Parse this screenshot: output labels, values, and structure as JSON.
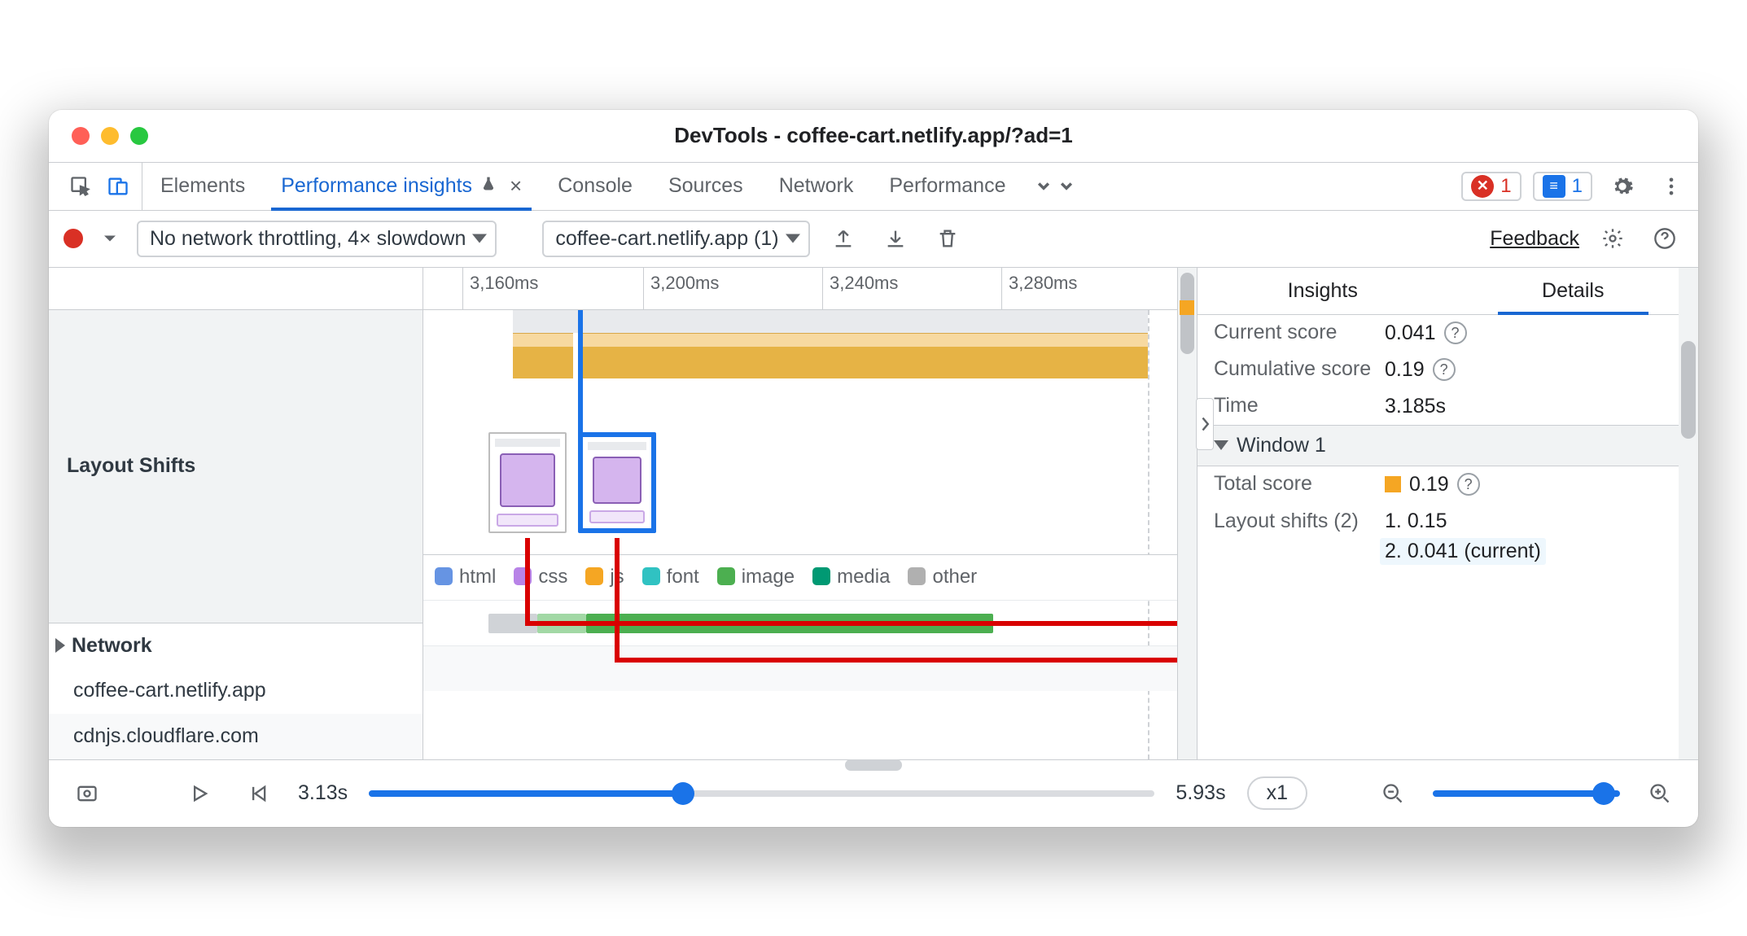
{
  "window": {
    "title": "DevTools - coffee-cart.netlify.app/?ad=1"
  },
  "top_tabs": {
    "items": [
      "Elements",
      "Performance insights",
      "Console",
      "Sources",
      "Network",
      "Performance"
    ],
    "active_index": 1,
    "experiment_badge": true,
    "error_count": "1",
    "message_count": "1"
  },
  "toolbar": {
    "throttling_select": "No network throttling, 4× slowdown",
    "recording_select": "coffee-cart.netlify.app (1)",
    "feedback_label": "Feedback"
  },
  "timeline": {
    "ticks": [
      "3,160ms",
      "3,200ms",
      "3,240ms",
      "3,280ms"
    ],
    "layout_shifts_label": "Layout Shifts",
    "network_label": "Network",
    "legend": [
      "html",
      "css",
      "js",
      "font",
      "image",
      "media",
      "other"
    ],
    "hosts": [
      "coffee-cart.netlify.app",
      "cdnjs.cloudflare.com"
    ]
  },
  "details": {
    "tabs": [
      "Insights",
      "Details"
    ],
    "active_tab": 1,
    "current_score_label": "Current score",
    "current_score_value": "0.041",
    "cumulative_score_label": "Cumulative score",
    "cumulative_score_value": "0.19",
    "time_label": "Time",
    "time_value": "3.185s",
    "window_section": "Window 1",
    "total_score_label": "Total score",
    "total_score_value": "0.19",
    "layout_shifts_label": "Layout shifts (2)",
    "shifts": [
      {
        "idx": "1.",
        "value": "0.15",
        "suffix": ""
      },
      {
        "idx": "2.",
        "value": "0.041",
        "suffix": "(current)"
      }
    ]
  },
  "playback": {
    "start_label": "3.13s",
    "end_label": "5.93s",
    "speed": "x1"
  },
  "colors": {
    "blue": "#1a73e8",
    "red_annotation": "#d90000",
    "orange": "#f5a623"
  }
}
